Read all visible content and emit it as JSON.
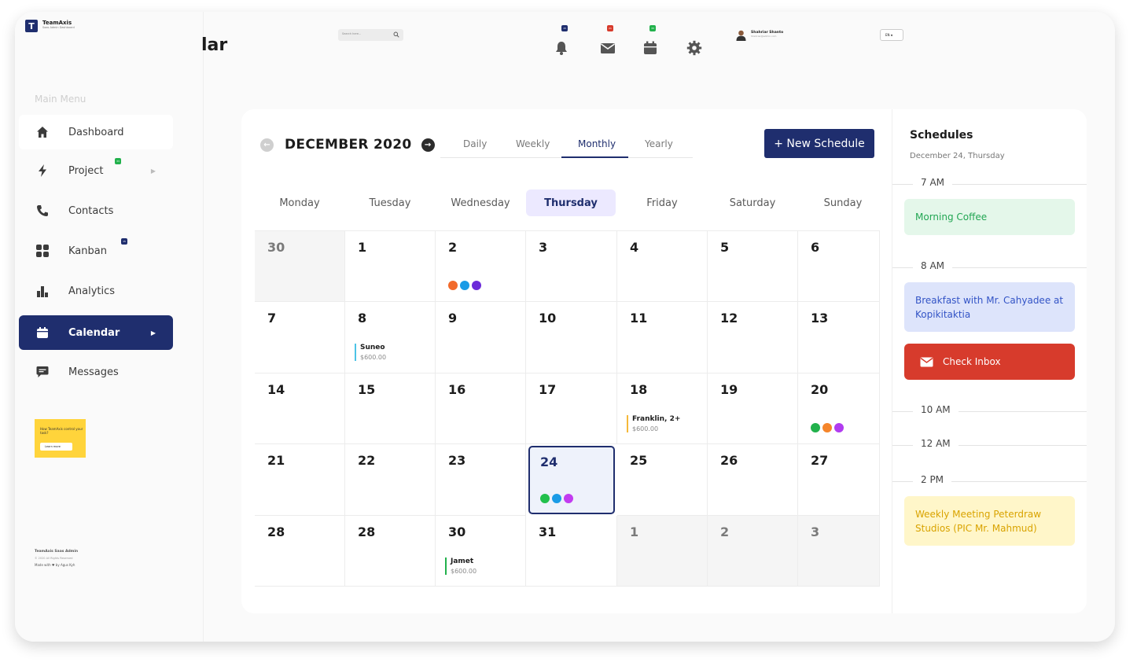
{
  "brand": {
    "name": "TeamAxis",
    "sub": "Saas Admin Dashboard"
  },
  "page_title": "lar",
  "search": {
    "placeholder": "Search here..."
  },
  "top_icons": {
    "notifications_badge": "15",
    "mail_badge": "21",
    "calendar_badge": "33"
  },
  "user": {
    "name": "Shahriar Shanto",
    "email": "Shahriar@admin.com"
  },
  "lang": {
    "value": "EN"
  },
  "sidebar": {
    "menu_title": "Main Menu",
    "items": [
      {
        "label": "Dashboard"
      },
      {
        "label": "Project",
        "badge": "33"
      },
      {
        "label": "Contacts"
      },
      {
        "label": "Kanban",
        "badge": "15"
      },
      {
        "label": "Analytics"
      },
      {
        "label": "Calendar"
      },
      {
        "label": "Messages"
      }
    ],
    "promo": {
      "text": "How TeamAxis control your task?",
      "button": "Learn more"
    },
    "footer": {
      "line1": "TeamAxis Saas Admin",
      "line2": "© 2020 All Rights Reserved",
      "line3": "Made with ♥ by Agus Kyh"
    }
  },
  "calendar": {
    "month": "DECEMBER 2020",
    "tabs": [
      "Daily",
      "Weekly",
      "Monthly",
      "Yearly"
    ],
    "active_tab": "Monthly",
    "new_button": "+ New Schedule",
    "weekdays": [
      "Monday",
      "Tuesday",
      "Wednesday",
      "Thursday",
      "Friday",
      "Saturday",
      "Sunday"
    ],
    "today_weekday": "Thursday",
    "weeks": [
      [
        "30",
        "1",
        "2",
        "3",
        "4",
        "5",
        "6"
      ],
      [
        "7",
        "8",
        "9",
        "10",
        "11",
        "12",
        "13"
      ],
      [
        "14",
        "15",
        "16",
        "17",
        "18",
        "19",
        "20"
      ],
      [
        "21",
        "22",
        "23",
        "24",
        "25",
        "26",
        "27"
      ],
      [
        "28",
        "28",
        "30",
        "31",
        "1",
        "2",
        "3"
      ]
    ],
    "selected_day": "24",
    "events": [
      {
        "name": "Suneo",
        "amount": "$600.00",
        "color": "#4cc3e6"
      },
      {
        "name": "Franklin, 2+",
        "amount": "$600.00",
        "color": "#f5b93a"
      },
      {
        "name": "Jamet",
        "amount": "$600.00",
        "color": "#22b14c"
      }
    ],
    "dot_colors": {
      "dec2": [
        "#f26a2b",
        "#1a9be6",
        "#6c2bd9"
      ],
      "dec20": [
        "#22b14c",
        "#f5852b",
        "#b13cf0"
      ],
      "dec24": [
        "#22c04c",
        "#1a9be6",
        "#c23cf0"
      ]
    }
  },
  "schedules": {
    "title": "Schedules",
    "date": "December 24, Thursday",
    "times": [
      "7 AM",
      "8 AM",
      "10 AM",
      "12 AM",
      "2 PM"
    ],
    "events": [
      {
        "text": "Morning Coffee"
      },
      {
        "text": "Breakfast with Mr. Cahyadee at Kopikitaktia"
      },
      {
        "text": "Check Inbox"
      },
      {
        "text": "Weekly Meeting Peterdraw Studios (PIC Mr. Mahmud)"
      }
    ]
  }
}
